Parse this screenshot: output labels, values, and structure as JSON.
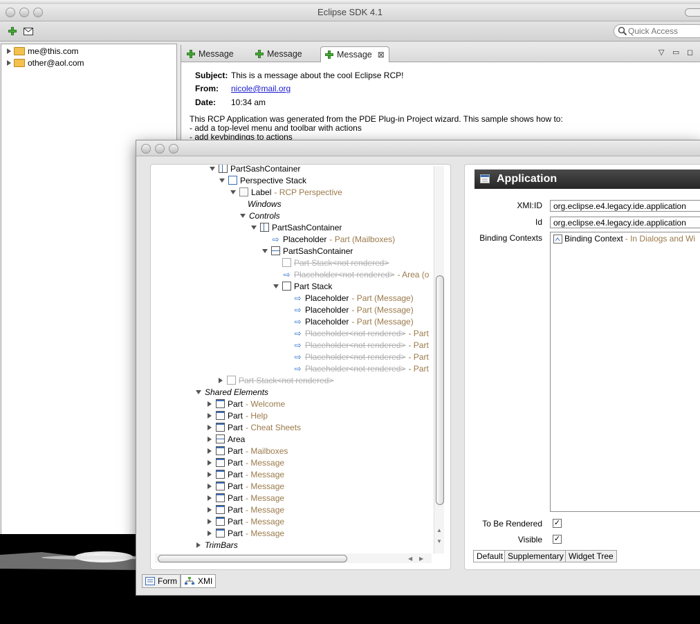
{
  "main_window": {
    "title": "Eclipse SDK 4.1",
    "quick_access_placeholder": "Quick Access"
  },
  "accounts": [
    "me@this.com",
    "other@aol.com"
  ],
  "editor": {
    "tabs": [
      {
        "label": "Message",
        "active": false
      },
      {
        "label": "Message",
        "active": false
      },
      {
        "label": "Message",
        "active": true
      }
    ],
    "subject_label": "Subject:",
    "subject_value": "This is a message about the cool Eclipse RCP!",
    "from_label": "From:",
    "from_value": "nicole@mail.org",
    "date_label": "Date:",
    "date_value": "10:34 am",
    "body_lines": [
      "This RCP Application was generated from the PDE Plug-in Project wizard. This sample shows how to:",
      "- add a top-level menu and toolbar with actions",
      "- add keybindings to actions"
    ]
  },
  "tree": {
    "nodes": [
      {
        "label": "PartSashContainer",
        "sub": ""
      },
      {
        "label": "Perspective Stack",
        "sub": ""
      },
      {
        "label": "Label",
        "sub": " - RCP Perspective"
      },
      {
        "label": "Windows",
        "sub": ""
      },
      {
        "label": "Controls",
        "sub": ""
      },
      {
        "label": "PartSashContainer",
        "sub": ""
      },
      {
        "label": "Placeholder",
        "sub": " - Part (Mailboxes)"
      },
      {
        "label": "PartSashContainer",
        "sub": ""
      },
      {
        "label": "Part Stack<not rendered>",
        "sub": ""
      },
      {
        "label": "Placeholder<not rendered>",
        "sub": " - Area (o"
      },
      {
        "label": "Part Stack",
        "sub": ""
      },
      {
        "label": "Placeholder",
        "sub": " - Part (Message)"
      },
      {
        "label": "Placeholder",
        "sub": " - Part (Message)"
      },
      {
        "label": "Placeholder",
        "sub": " - Part (Message)"
      },
      {
        "label": "Placeholder<not rendered>",
        "sub": " - Part"
      },
      {
        "label": "Placeholder<not rendered>",
        "sub": " - Part"
      },
      {
        "label": "Placeholder<not rendered>",
        "sub": " - Part"
      },
      {
        "label": "Placeholder<not rendered>",
        "sub": " - Part"
      },
      {
        "label": "Part Stack<not rendered>",
        "sub": ""
      },
      {
        "label": "Shared Elements",
        "sub": ""
      },
      {
        "label": "Part",
        "sub": " - Welcome"
      },
      {
        "label": "Part",
        "sub": " - Help"
      },
      {
        "label": "Part",
        "sub": " - Cheat Sheets"
      },
      {
        "label": "Area",
        "sub": ""
      },
      {
        "label": "Part",
        "sub": " - Mailboxes"
      },
      {
        "label": "Part",
        "sub": " - Message"
      },
      {
        "label": "Part",
        "sub": " - Message"
      },
      {
        "label": "Part",
        "sub": " - Message"
      },
      {
        "label": "Part",
        "sub": " - Message"
      },
      {
        "label": "Part",
        "sub": " - Message"
      },
      {
        "label": "Part",
        "sub": " - Message"
      },
      {
        "label": "Part",
        "sub": " - Message"
      },
      {
        "label": "TrimBars",
        "sub": ""
      }
    ]
  },
  "form": {
    "header": "Application",
    "xmi_label": "XMI:ID",
    "xmi_value": "org.eclipse.e4.legacy.ide.application",
    "id_label": "Id",
    "id_value": "org.eclipse.e4.legacy.ide.application",
    "binding_label": "Binding Contexts",
    "binding_item": "Binding Context",
    "binding_item_sub": " - In Dialogs and Wi",
    "rendered_label": "To Be Rendered",
    "visible_label": "Visible",
    "tabs": [
      "Default",
      "Supplementary",
      "Widget Tree"
    ]
  },
  "bottom_tabs": [
    "Form",
    "XMI"
  ],
  "colors": {
    "accent_green": "#4caf3c",
    "attr_brown": "#9a7a4a",
    "link_blue": "#1a1ad0"
  }
}
